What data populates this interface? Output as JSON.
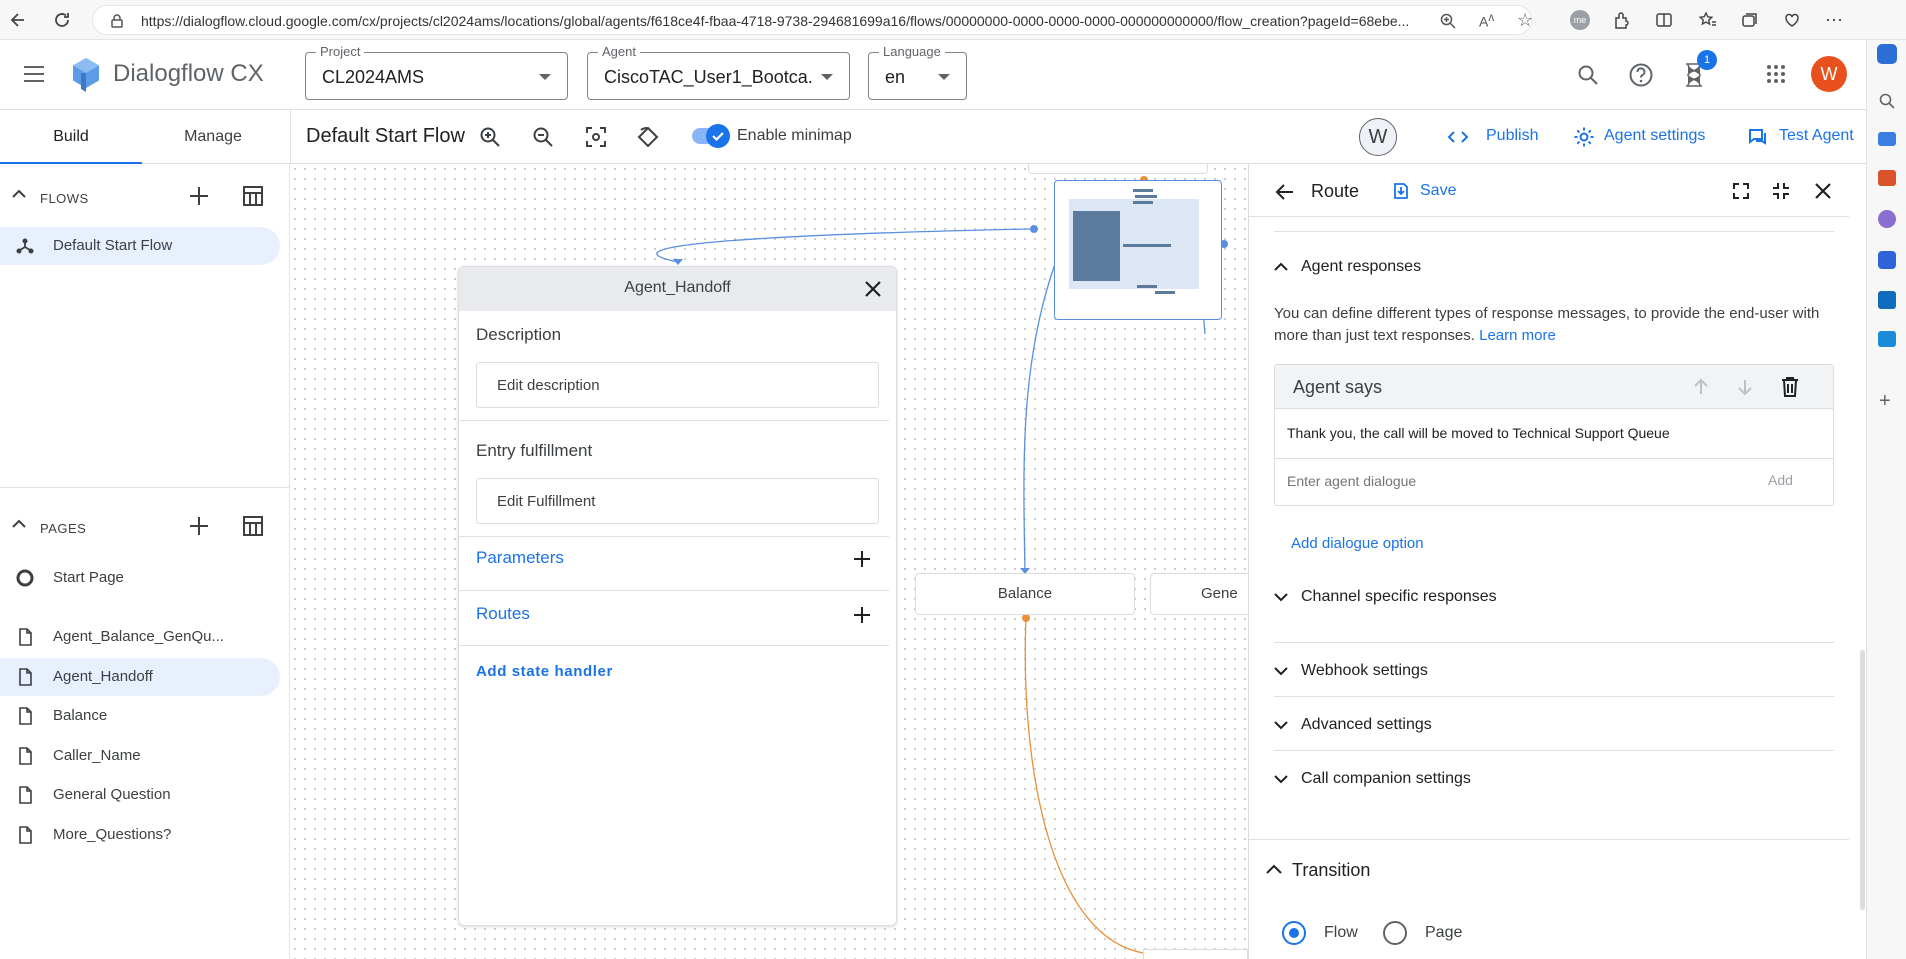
{
  "browser": {
    "url": "https://dialogflow.cloud.google.com/cx/projects/cl2024ams/locations/global/agents/f618ce4f-fbaa-4718-9738-294681699a16/flows/00000000-0000-0000-0000-000000000000/flow_creation?pageId=68ebe...",
    "profile_initials": "me",
    "notification_count": "1"
  },
  "header": {
    "app_name": "Dialogflow CX",
    "project": {
      "label": "Project",
      "value": "CL2024AMS"
    },
    "agent": {
      "label": "Agent",
      "value": "CiscoTAC_User1_Bootca..."
    },
    "language": {
      "label": "Language",
      "value": "en"
    },
    "notification_badge": "1",
    "avatar_letter": "W"
  },
  "toolbar": {
    "tabs": [
      "Build",
      "Manage"
    ],
    "flow_title": "Default Start Flow",
    "minimap_label": "Enable minimap",
    "user_bubble": "W",
    "publish_label": "Publish",
    "agent_settings_label": "Agent settings",
    "test_agent_label": "Test Agent"
  },
  "left_nav": {
    "flows_title": "FLOWS",
    "flows": [
      "Default Start Flow"
    ],
    "pages_title": "PAGES",
    "pages": [
      "Start Page",
      "Agent_Balance_GenQu...",
      "Agent_Handoff",
      "Balance",
      "Caller_Name",
      "General Question",
      "More_Questions?"
    ],
    "selected_page": "Agent_Handoff"
  },
  "canvas": {
    "nodes": [
      "Balance",
      "Gene"
    ]
  },
  "page_panel": {
    "title": "Agent_Handoff",
    "description_label": "Description",
    "description_button": "Edit description",
    "entry_label": "Entry fulfillment",
    "entry_button": "Edit Fulfillment",
    "parameters_label": "Parameters",
    "routes_label": "Routes",
    "add_state_handler": "Add state handler"
  },
  "route_panel": {
    "title": "Route",
    "save_label": "Save",
    "agent_responses_title": "Agent responses",
    "agent_responses_desc": "You can define different types of response messages, to provide the end-user with more than just text responses.",
    "learn_more": "Learn more",
    "agent_says_title": "Agent says",
    "agent_says_text": "Thank you, the call will be moved to Technical Support Queue",
    "dialogue_placeholder": "Enter agent dialogue",
    "add_button": "Add",
    "add_dialogue_option": "Add dialogue option",
    "sections": [
      "Channel specific responses",
      "Webhook settings",
      "Advanced settings",
      "Call companion settings"
    ],
    "transition_title": "Transition",
    "transition_options": [
      "Flow",
      "Page"
    ],
    "transition_selected": "Flow"
  },
  "colors": {
    "accent": "#1a73e8",
    "selected_bg": "#e8f0fe",
    "avatar": "#e8501e",
    "route_line_blue": "#5a8fe0",
    "route_line_orange": "#e8903a"
  }
}
